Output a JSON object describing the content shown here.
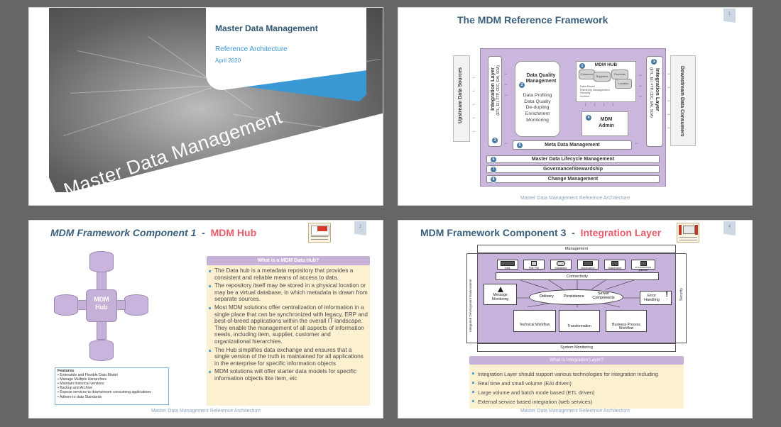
{
  "window": {
    "background": "#666666"
  },
  "slides": [
    {
      "title": "Master Data Management",
      "subtitle": "Reference Architecture",
      "date": "April 2020",
      "watermark": "Master Data Management",
      "colors": {
        "title": "#2f5673",
        "accent": "#3a98d4"
      }
    },
    {
      "title": "The MDM Reference Framework",
      "page_number": "1",
      "footer": "Master Data Management Reference Architecture",
      "diagram": {
        "upstream": "Upstream Data Sources",
        "downstream": "Downstream Data  Consumers",
        "integration_left": {
          "title": "Integration Layer",
          "subtitle": "(ETL, EII, FTP, CDC, EAI, SOA)",
          "num": "3"
        },
        "integration_right": {
          "title": "Integration Layer",
          "subtitle": "(ETL, EII, FTP, CDC, EAI, SOA)",
          "num": "3"
        },
        "dq": {
          "num": "2",
          "title": "Data Quality Management",
          "items": [
            "Data Profiling",
            "Data Quality",
            "De-dupling",
            "Enrichment",
            "Monitoring"
          ]
        },
        "hub": {
          "num": "1",
          "title": "MDM HUB",
          "stores": [
            "Customer",
            "Suppliers",
            "Products",
            "Location"
          ],
          "details": [
            "Data Model",
            "Hierarchy Management",
            "Security",
            "Archive"
          ]
        },
        "admin": {
          "num": "4",
          "title": "MDM Admin"
        },
        "meta": {
          "num": "5",
          "title": "Meta Data Management"
        },
        "bars": [
          {
            "num": "6",
            "title": "Master Data Lifecycle Management"
          },
          {
            "num": "7",
            "title": "Governance/Stewardship"
          },
          {
            "num": "8",
            "title": "Change Management"
          }
        ],
        "colors": {
          "frame": "#cbb7de",
          "badge": "#4a7aa0"
        }
      }
    },
    {
      "title_main": "MDM Framework Component 1",
      "title_sep": "-",
      "title_accent": "MDM Hub",
      "page_number": "2",
      "footer": "Master Data Management Reference Architecture",
      "hub_label": "MDM Hub",
      "features_title": "Features",
      "features": [
        "Extensible and Flexible Data Model",
        "Manage Multiple Hierarchies",
        "Maintain historical versions",
        "Backup and Archive",
        "Expose services to downstream consuming applications",
        "Adhere to data Standards"
      ],
      "what_title": "What is a MDM Data Hub?",
      "bullets": [
        "The Data hub is a metadata repository that provides a consistent and reliable means of access to data.",
        "The repository itself may be stored in a physical location or may be a virtual database, in which metadata is drawn from separate sources.",
        "Most MDM solutions offer centralization of information in a single place that can be synchronized with legacy, ERP and best-of-breed applications within the overall IT landscape. They enable the management of all aspects of information needs, including item, supplier, customer and organizational hierarchies.",
        "The Hub simplifies data exchange and ensures that a single version of the truth is maintained for all applications in the enterprise for specific information objects",
        "MDM solutions will offer starter data models for specific information objects like item, etc"
      ],
      "colors": {
        "accent": "#e85b6b",
        "hub": "#c5b1d8",
        "panel": "#fbf0d0"
      }
    },
    {
      "title_main": "MDM Framework Component 3",
      "title_sep": "-",
      "title_accent": "Integration Layer",
      "page_number": "4",
      "footer": "Master Data Management Reference Architecture",
      "diagram": {
        "management": "Management",
        "system_monitoring": "System Monitoring",
        "ide": "Integrated  Development Environment",
        "security": "Security",
        "sources": [
          "XML",
          "Flat File",
          "Database",
          "Application",
          "Mainframe",
          "e-commerce partner"
        ],
        "connectivity": "Connectivity",
        "message_monitoring": "Message Monitoring",
        "core": [
          "Delivery",
          "Persistence",
          "Server Components"
        ],
        "error_handling": "Error Handling",
        "workflows": [
          "Technical Workflow",
          "Transformation",
          "Business Process Workflow"
        ]
      },
      "what_title": "What is Integration Layer?",
      "bullets": [
        "Integration Layer should support various technologies for integration including",
        "Real time and small volume (EAI driven)",
        "Large volume and batch mode based (ETL driven)",
        "External service based integration (web services)"
      ]
    }
  ]
}
